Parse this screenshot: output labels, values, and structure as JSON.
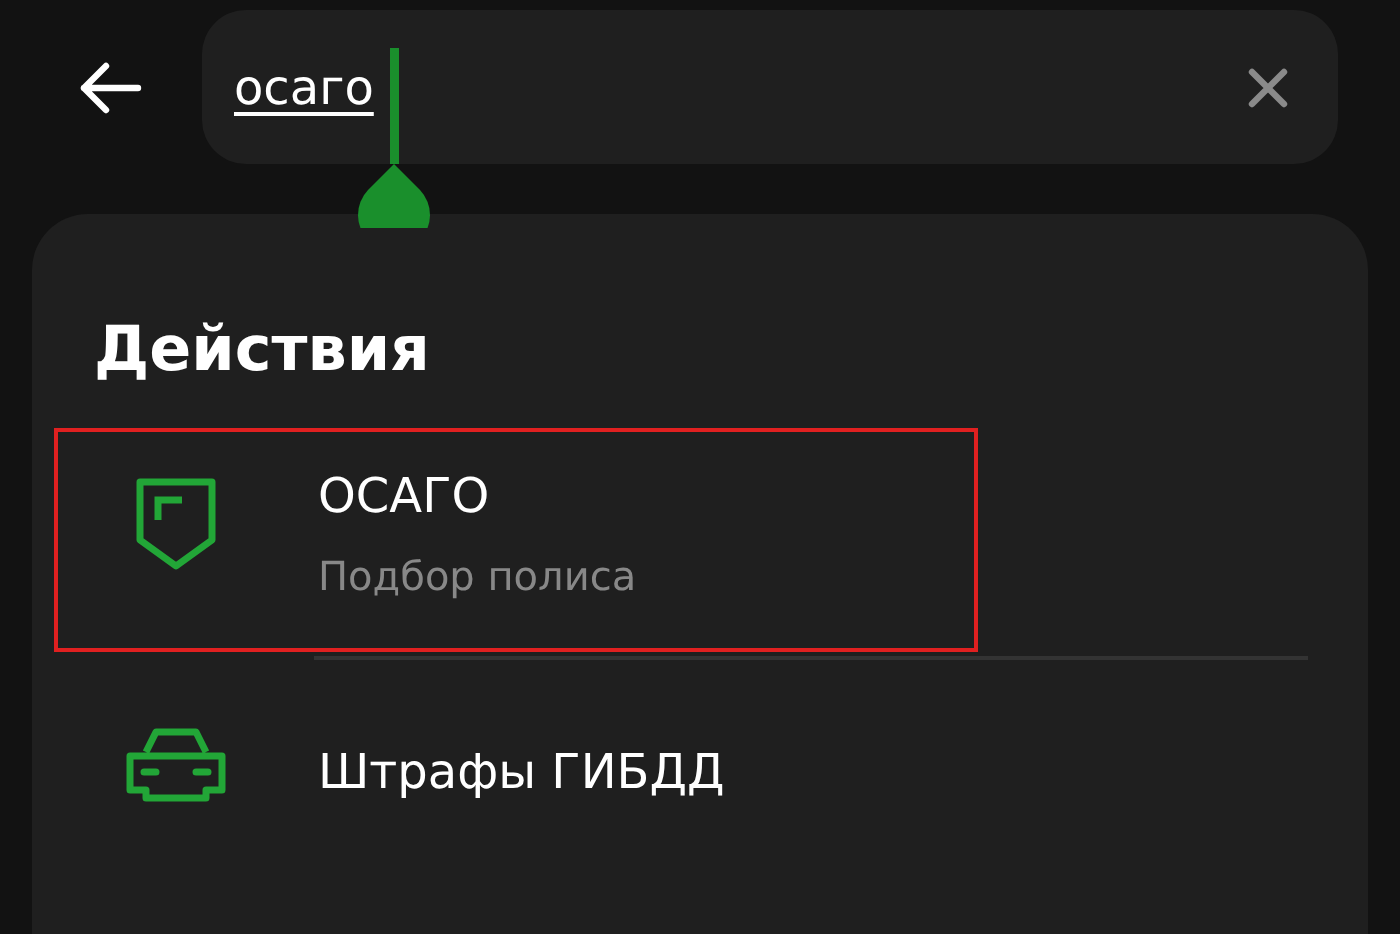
{
  "search": {
    "value": "осаго"
  },
  "section": {
    "title": "Действия"
  },
  "items": [
    {
      "kind": "shield",
      "title": "ОСАГО",
      "subtitle": "Подбор полиса",
      "highlighted": true
    },
    {
      "kind": "car",
      "title": "Штрафы ГИБДД",
      "highlighted": false
    }
  ]
}
